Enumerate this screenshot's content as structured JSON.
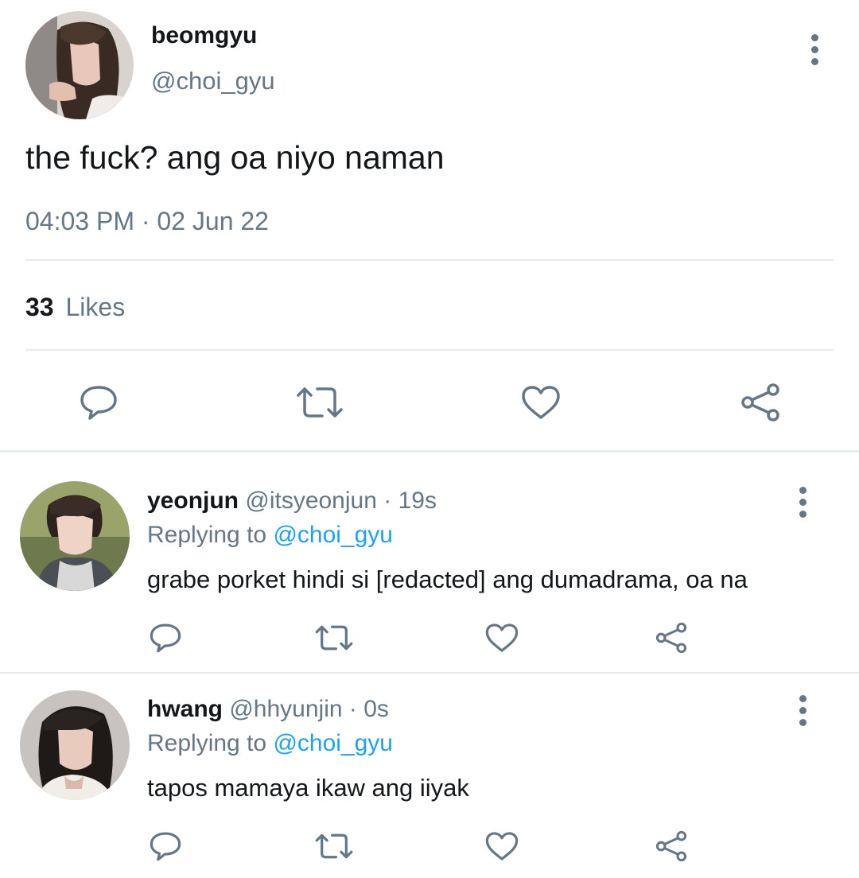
{
  "main_tweet": {
    "display_name": "beomgyu",
    "handle": "@choi_gyu",
    "text": "the fuck? ang oa niyo naman",
    "timestamp": "04:03 PM · 02 Jun 22",
    "likes_count": "33",
    "likes_label": "Likes"
  },
  "replies": [
    {
      "display_name": "yeonjun",
      "handle": "@itsyeonjun",
      "time": "· 19s",
      "replying_prefix": "Replying to",
      "replying_to": "@choi_gyu",
      "text": "grabe porket hindi si [redacted] ang dumadrama, oa na"
    },
    {
      "display_name": "hwang",
      "handle": "@hhyunjin",
      "time": "· 0s",
      "replying_prefix": "Replying to",
      "replying_to": "@choi_gyu",
      "text": "tapos mamaya ikaw ang iiyak"
    }
  ],
  "icons": {
    "action_row": [
      "reply-icon",
      "retweet-icon",
      "like-icon",
      "share-icon"
    ],
    "menu": "more-options-icon"
  },
  "colors": {
    "text": "#14171a",
    "muted": "#657786",
    "link": "#1da1f2",
    "divider": "#e6ecf0"
  }
}
